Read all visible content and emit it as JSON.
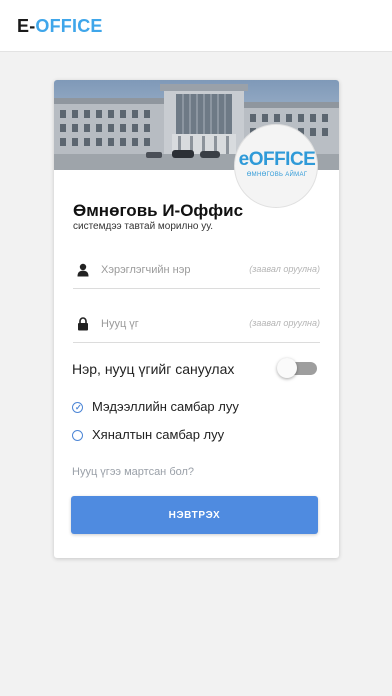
{
  "app": {
    "brand_prefix": "E-",
    "brand_suffix": "OFFICE"
  },
  "logo": {
    "main": "eOFFICE",
    "sub": "ӨМНӨГОВЬ АЙМАГ"
  },
  "login": {
    "title": "Өмнөговь И-Оффис",
    "subtitle": "системдээ тавтай морилно уу.",
    "username": {
      "placeholder": "Хэрэглэгчийн нэр",
      "value": "",
      "required_hint": "(заавал оруулна)",
      "icon": "user-icon"
    },
    "password": {
      "placeholder": "Нууц үг",
      "value": "",
      "required_hint": "(заавал оруулна)",
      "icon": "lock-icon"
    },
    "remember_label": "Нэр, нууц үгийг сануулах",
    "remember_on": false,
    "destinations": [
      {
        "label": "Мэдээллийн самбар луу",
        "selected": true
      },
      {
        "label": "Хяналтын самбар луу",
        "selected": false
      }
    ],
    "forgot_label": "Нууц үгээ мартсан бол?",
    "submit_label": "НЭВТРЭХ"
  },
  "colors": {
    "brand_blue": "#3fa6ea",
    "button_blue": "#4f8be0",
    "radio_blue": "#4d86d6",
    "toggle_off": "#9e9e9e"
  }
}
